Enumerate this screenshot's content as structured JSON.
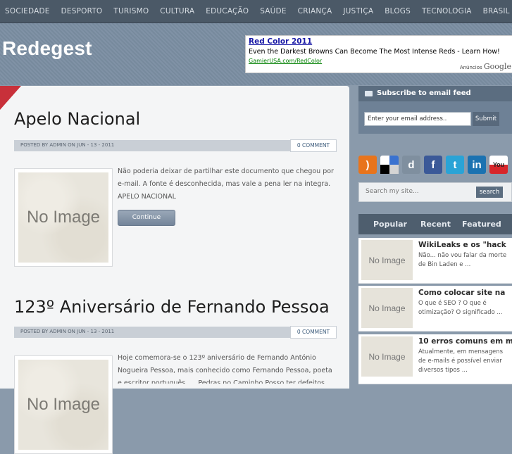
{
  "nav": [
    "SOCIEDADE",
    "DESPORTO",
    "TURISMO",
    "CULTURA",
    "EDUCAÇÃO",
    "SAÚDE",
    "CRIANÇA",
    "JUSTIÇA",
    "BLOGS",
    "TECNOLOGIA",
    "BRASIL"
  ],
  "site": {
    "name": "Redegest"
  },
  "ad": {
    "title": "Red Color 2011",
    "text": "Even the Darkest Browns Can Become The Most Intense Reds - Learn How!",
    "url": "GamierUSA.com/RedColor",
    "label": "Anúncios",
    "brand": "Google"
  },
  "posts": [
    {
      "title": "Apelo Nacional",
      "meta": "POSTED BY ADMIN ON JUN - 13 - 2011",
      "comments": "0 COMMENT",
      "thumb": "No Image",
      "excerpt": "Não poderia deixar de partilhar este documento que chegou por e-mail. A fonte é desconhecida, mas vale a pena ler na integra. APELO NACIONAL",
      "continue": "Continue"
    },
    {
      "title": "123º Aniversário de Fernando Pessoa",
      "meta": "POSTED BY ADMIN ON JUN - 13 - 2011",
      "comments": "0 COMMENT",
      "thumb": "No Image",
      "excerpt": "Hoje comemora-se o 123º aniversário de Fernando António Nogueira Pessoa, mais conhecido como Fernando Pessoa, poeta e escritor português. ... Pedras no Caminho Posso ter defeitos"
    }
  ],
  "sidebar": {
    "subscribe": {
      "title": "Subscribe to email feed",
      "email_placeholder": "Enter your email address..",
      "submit": "Submit"
    },
    "social": [
      {
        "icon": "rss-icon",
        "glyph": ")",
        "color": "#e8741c"
      },
      {
        "icon": "delicious-icon",
        "glyph": "",
        "color": "#3a72d0"
      },
      {
        "icon": "digg-icon",
        "glyph": "d",
        "color": "#7f8f9f"
      },
      {
        "icon": "facebook-icon",
        "glyph": "f",
        "color": "#3b5998"
      },
      {
        "icon": "twitter-icon",
        "glyph": "t",
        "color": "#2aa3d6"
      },
      {
        "icon": "linkedin-icon",
        "glyph": "in",
        "color": "#1b72b1"
      },
      {
        "icon": "youtube-icon",
        "glyph": "You",
        "color": "#d8262a"
      }
    ],
    "search": {
      "placeholder": "Search my site...",
      "button": "search"
    },
    "tabs": [
      "Popular",
      "Recent",
      "Featured"
    ],
    "items": [
      {
        "thumb": "No Image",
        "title": "WikiLeaks e os \"hack",
        "text": "Não... não vou falar da morte de Bin Laden e ..."
      },
      {
        "thumb": "No Image",
        "title": "Como colocar site na",
        "text": " O que é SEO ? O que é otimização? O significado ..."
      },
      {
        "thumb": "No Image",
        "title": "10 erros comuns em m",
        "text": "Atualmente, em mensagens de e-mails é possível enviar diversos tipos ..."
      }
    ]
  }
}
